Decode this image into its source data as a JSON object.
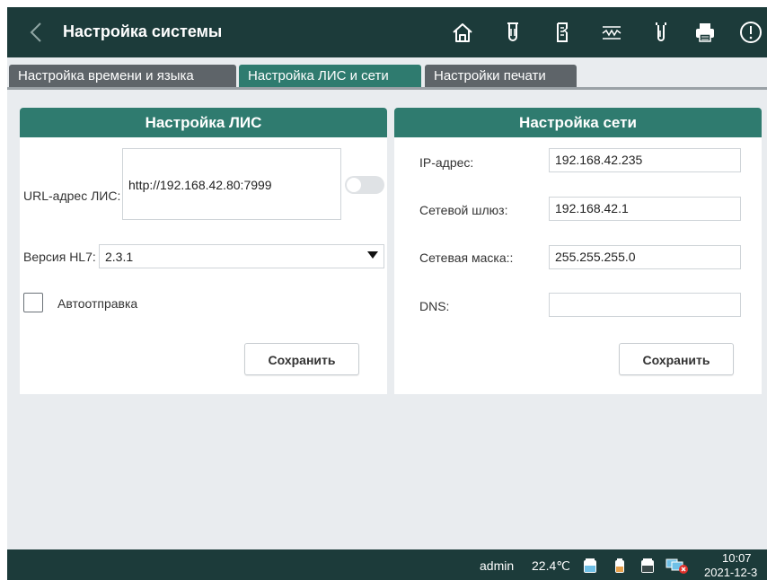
{
  "header": {
    "title": "Настройка системы",
    "icons": [
      "back-icon",
      "home-icon",
      "test-tube-icon",
      "report-icon",
      "waveform-icon",
      "sample-tube-icon",
      "printer-icon",
      "alert-icon"
    ]
  },
  "tabs": [
    {
      "label": "Настройка времени и языка",
      "active": false
    },
    {
      "label": "Настройка ЛИС и сети",
      "active": true
    },
    {
      "label": "Настройки печати",
      "active": false
    }
  ],
  "lis": {
    "title": "Настройка ЛИС",
    "url_label": "URL-адрес ЛИС:",
    "url_value": "http://192.168.42.80:7999",
    "hl7_label": "Версия HL7:",
    "hl7_value": "2.3.1",
    "auto_send_label": "Автоотправка",
    "auto_send_checked": false,
    "save_label": "Сохранить"
  },
  "network": {
    "title": "Настройка сети",
    "ip_label": "IP-адрес:",
    "ip_value": "192.168.42.235",
    "gateway_label": "Сетевой шлюз:",
    "gateway_value": "192.168.42.1",
    "mask_label": "Сетевая маска::",
    "mask_value": "255.255.255.0",
    "dns_label": "DNS:",
    "dns_value": "",
    "save_label": "Сохранить"
  },
  "status": {
    "user": "admin",
    "temperature": "22.4℃",
    "time": "10:07",
    "date": "2021-12-3"
  },
  "colors": {
    "topbar": "#1c3b3a",
    "accent": "#2f7b6f",
    "tab_inactive": "#5e6469",
    "reagent_blue": "#6fc0e6",
    "reagent_orange": "#e6a04a",
    "error_red": "#e0312b"
  }
}
